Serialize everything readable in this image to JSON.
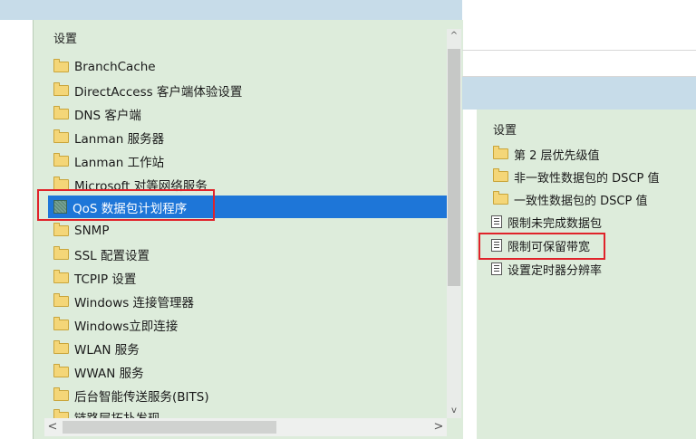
{
  "left_panel": {
    "header": "设置",
    "items": [
      {
        "label": "BranchCache",
        "icon": "folder-icon"
      },
      {
        "label": "DirectAccess 客户端体验设置",
        "icon": "folder-icon"
      },
      {
        "label": "DNS 客户端",
        "icon": "folder-icon"
      },
      {
        "label": "Lanman 服务器",
        "icon": "folder-icon"
      },
      {
        "label": "Lanman 工作站",
        "icon": "folder-icon"
      },
      {
        "label": "Microsoft 对等网络服务",
        "icon": "folder-icon"
      },
      {
        "label": "QoS 数据包计划程序",
        "icon": "policy-icon",
        "selected": true
      },
      {
        "label": "SNMP",
        "icon": "folder-icon"
      },
      {
        "label": "SSL 配置设置",
        "icon": "folder-icon"
      },
      {
        "label": "TCPIP 设置",
        "icon": "folder-icon"
      },
      {
        "label": "Windows 连接管理器",
        "icon": "folder-icon"
      },
      {
        "label": "Windows立即连接",
        "icon": "folder-icon"
      },
      {
        "label": "WLAN 服务",
        "icon": "folder-icon"
      },
      {
        "label": "WWAN 服务",
        "icon": "folder-icon"
      },
      {
        "label": "后台智能传送服务(BITS)",
        "icon": "folder-icon"
      },
      {
        "label": "链路层拓扑发现",
        "icon": "folder-icon"
      }
    ],
    "scroll_up": "^",
    "scroll_down": "v",
    "scroll_left": "<",
    "scroll_right": ">"
  },
  "right_panel": {
    "header": "设置",
    "items": [
      {
        "label": "第 2 层优先级值",
        "icon": "folder-icon"
      },
      {
        "label": "非一致性数据包的 DSCP 值",
        "icon": "folder-icon"
      },
      {
        "label": "一致性数据包的 DSCP 值",
        "icon": "folder-icon"
      },
      {
        "label": "限制未完成数据包",
        "icon": "setting-icon"
      },
      {
        "label": "限制可保留带宽",
        "icon": "setting-icon",
        "highlighted": true
      },
      {
        "label": "设置定时器分辨率",
        "icon": "setting-icon"
      }
    ]
  },
  "colors": {
    "panel_bg": "#ddecdb",
    "selection": "#1e76d8",
    "highlight_box": "#e0232a"
  }
}
